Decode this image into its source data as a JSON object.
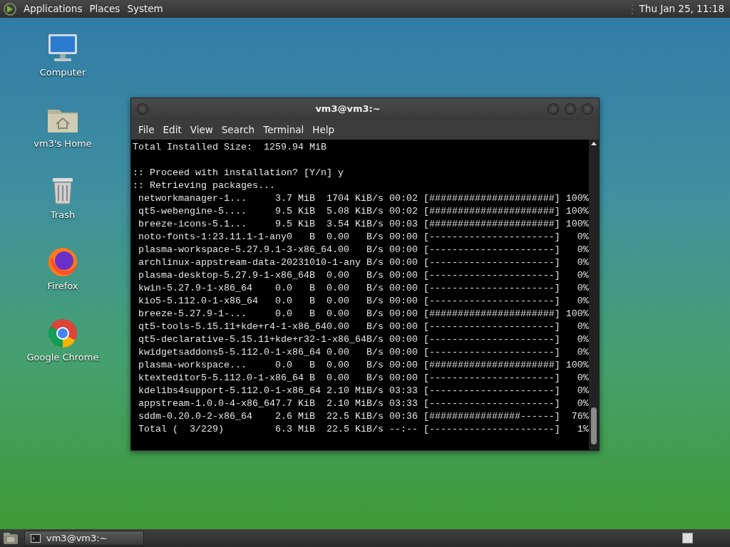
{
  "top_panel": {
    "menus": [
      "Applications",
      "Places",
      "System"
    ],
    "clock": "Thu Jan 25, 11:18"
  },
  "desktop_icons": [
    {
      "label": "Computer",
      "kind": "computer"
    },
    {
      "label": "vm3's Home",
      "kind": "home"
    },
    {
      "label": "Trash",
      "kind": "trash"
    },
    {
      "label": "Firefox",
      "kind": "firefox"
    },
    {
      "label": "Google Chrome",
      "kind": "chrome"
    }
  ],
  "terminal_window": {
    "title": "vm3@vm3:~",
    "menus": [
      "File",
      "Edit",
      "View",
      "Search",
      "Terminal",
      "Help"
    ],
    "summary": "Total Installed Size:  1259.94 MiB",
    "lines": [
      ":: Proceed with installation? [Y/n] y",
      ":: Retrieving packages...",
      " networkmanager-1...     3.7 MiB  1704 KiB/s 00:02 [######################] 100%",
      " qt5-webengine-5....     9.5 KiB  5.08 KiB/s 00:02 [######################] 100%",
      " breeze-icons-5.1...     9.5 KiB  3.54 KiB/s 00:03 [######################] 100%",
      " noto-fonts-1:23.11.1-1-any0   B  0.00   B/s 00:00 [----------------------]   0%",
      " plasma-workspace-5.27.9.1-3-x86_64.00   B/s 00:00 [----------------------]   0%",
      " archlinux-appstream-data-20231010-1-any B/s 00:00 [----------------------]   0%",
      " plasma-desktop-5.27.9-1-x86_64B  0.00   B/s 00:00 [----------------------]   0%",
      " kwin-5.27.9-1-x86_64    0.0   B  0.00   B/s 00:00 [----------------------]   0%",
      " kio5-5.112.0-1-x86_64   0.0   B  0.00   B/s 00:00 [----------------------]   0%",
      " breeze-5.27.9-1-...     0.0   B  0.00   B/s 00:00 [######################] 100%",
      " qt5-tools-5.15.11+kde+r4-1-x86_640.00   B/s 00:00 [----------------------]   0%",
      " qt5-declarative-5.15.11+kde+r32-1-x86_64B/s 00:00 [----------------------]   0%",
      " kwidgetsaddons5-5.112.0-1-x86_64 0.00   B/s 00:00 [----------------------]   0%",
      " plasma-workspace...     0.0   B  0.00   B/s 00:00 [######################] 100%",
      " ktexteditor5-5.112.0-1-x86_64 B  0.00   B/s 00:00 [----------------------]   0%",
      " kdelibs4support-5.112.0-1-x86_64 2.10 MiB/s 03:33 [----------------------]   0%",
      " appstream-1.0.0-4-x86_647.7 KiB  2.10 MiB/s 03:33 [----------------------]   0%",
      " sddm-0.20.0-2-x86_64    2.6 MiB  22.5 KiB/s 00:36 [################------]  76%",
      " Total (  3/229)         6.3 MiB  22.5 KiB/s --:-- [----------------------]   1%"
    ]
  },
  "taskbar": {
    "tasks": [
      {
        "label": "vm3@vm3:~"
      }
    ]
  }
}
